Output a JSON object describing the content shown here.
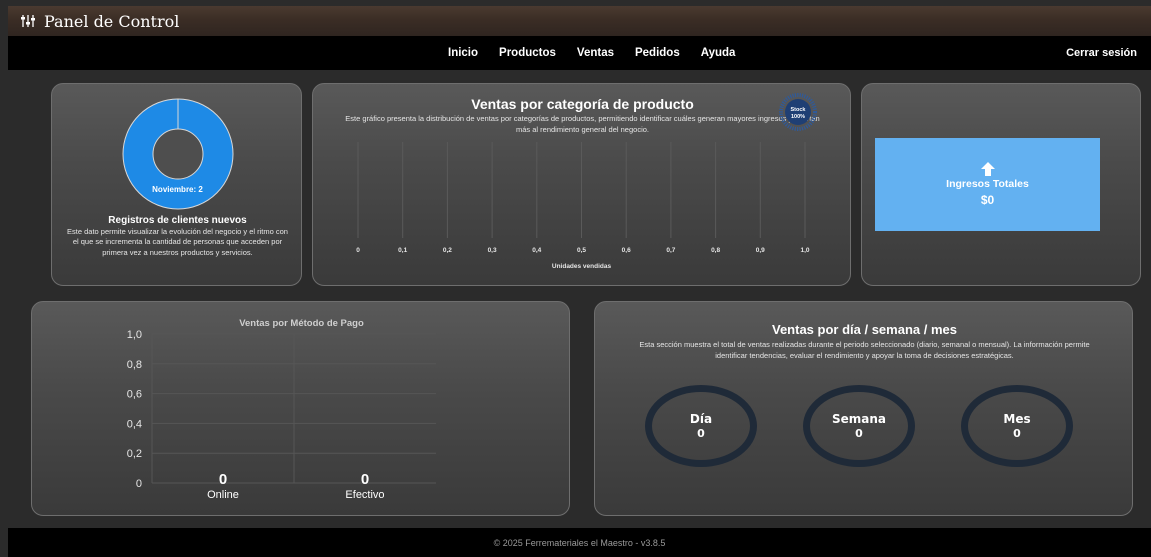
{
  "app": {
    "title": "Panel de Control",
    "icon": "sliders-icon"
  },
  "nav": {
    "items": [
      "Inicio",
      "Productos",
      "Ventas",
      "Pedidos",
      "Ayuda"
    ],
    "logout": "Cerrar sesión"
  },
  "clients_card": {
    "title": "Registros de clientes nuevos",
    "description": "Este dato permite visualizar la evolución del negocio y el ritmo con el que se incrementa la cantidad de personas que acceden por primera vez a nuestros productos y servicios.",
    "donut_label": "Noviembre: 2",
    "color": "#1e8ae6"
  },
  "category_card": {
    "title": "Ventas por categoría de producto",
    "description": "Este gráfico presenta la distribución de ventas por categorías de productos, permitiendo identificar cuáles generan mayores ingresos y aportan más al rendimiento general del negocio.",
    "badge": {
      "line1": "Stock",
      "line2": "100%"
    }
  },
  "ingresos_card": {
    "label": "Ingresos Totales",
    "value": "$0",
    "color": "#63b1f1",
    "icon": "arrow-up-icon"
  },
  "payment_card": {
    "title": "Ventas por Método de Pago"
  },
  "periods_card": {
    "title": "Ventas por día / semana / mes",
    "description_line1": "Esta sección muestra el total de ventas realizadas durante el periodo seleccionado (diario, semanal o mensual). La información permite",
    "description_line2": "identificar tendencias, evaluar el rendimiento y apoyar la toma de decisiones estratégicas.",
    "rings": [
      {
        "label": "Día",
        "value": "0"
      },
      {
        "label": "Semana",
        "value": "0"
      },
      {
        "label": "Mes",
        "value": "0"
      }
    ]
  },
  "footer": {
    "text": "© 2025 Ferremateriales el Maestro - v3.8.5"
  },
  "chart_data": [
    {
      "type": "bar",
      "orientation": "horizontal",
      "xlabel": "Unidades vendidas",
      "xlim": [
        0,
        1
      ],
      "x_ticks": [
        "0",
        "0,1",
        "0,2",
        "0,3",
        "0,4",
        "0,5",
        "0,6",
        "0,7",
        "0,8",
        "0,9",
        "1,0"
      ],
      "categories": [],
      "values": []
    },
    {
      "type": "bar",
      "title": "Ventas por Método de Pago",
      "categories": [
        "Online",
        "Efectivo"
      ],
      "values": [
        0,
        0
      ],
      "data_labels": [
        "0",
        "0"
      ],
      "ylim": [
        0,
        1
      ],
      "y_ticks": [
        "0",
        "0,2",
        "0,4",
        "0,6",
        "0,8",
        "1,0"
      ]
    },
    {
      "type": "pie",
      "variant": "donut",
      "categories": [
        "Noviembre"
      ],
      "values": [
        2
      ]
    }
  ]
}
